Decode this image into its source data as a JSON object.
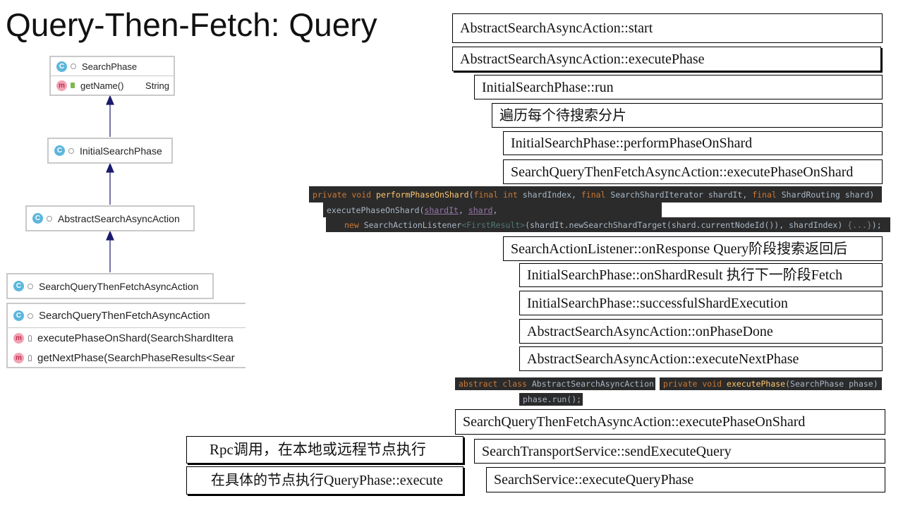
{
  "title": "Query-Then-Fetch: Query",
  "class_diagram": {
    "search_phase": {
      "icon": "C",
      "name": "SearchPhase",
      "method_icon": "m",
      "method": "getName()",
      "return_type": "String"
    },
    "initial_search_phase": {
      "icon": "C",
      "name": "InitialSearchPhase"
    },
    "abstract_search_async_action": {
      "icon": "C",
      "name": "AbstractSearchAsyncAction"
    },
    "search_query_then_fetch": {
      "icon": "C",
      "name": "SearchQueryThenFetchAsyncAction"
    },
    "detail": {
      "icon": "C",
      "name": "SearchQueryThenFetchAsyncAction",
      "methods": [
        {
          "icon": "m",
          "label": "executePhaseOnShard(SearchShardItera"
        },
        {
          "icon": "m",
          "label": "getNextPhase(SearchPhaseResults<Sear"
        }
      ]
    }
  },
  "call_stack": [
    "AbstractSearchAsyncAction::start",
    "AbstractSearchAsyncAction::executePhase",
    "InitialSearchPhase::run",
    "遍历每个待搜索分片",
    "InitialSearchPhase::performPhaseOnShard",
    "SearchQueryThenFetchAsyncAction::executePhaseOnShard",
    "SearchActionListener::onResponse Query阶段搜索返回后",
    "InitialSearchPhase::onShardResult  执行下一阶段Fetch",
    "InitialSearchPhase::successfulShardExecution",
    "AbstractSearchAsyncAction::onPhaseDone",
    "AbstractSearchAsyncAction::executeNextPhase",
    "SearchQueryThenFetchAsyncAction::executePhaseOnShard",
    "SearchTransportService::sendExecuteQuery",
    "SearchService::executeQueryPhase"
  ],
  "notes": {
    "rpc": "Rpc调用，在本地或远程节点执行",
    "query_phase": "在具体的节点执行QueryPhase::execute"
  },
  "code": {
    "perform_phase": {
      "line1": {
        "kw1": "private void ",
        "fn": "performPhaseOnShard",
        "p1": "(",
        "kw2": "final int ",
        "a1": "shardIndex, ",
        "kw3": "final ",
        "a2": "SearchShardIterator shardIt, ",
        "kw4": "final ",
        "a3": "ShardRouting shard)"
      },
      "line2": {
        "a1": "executePhaseOnShard(",
        "v1": "shardIt",
        "a2": ", ",
        "v2": "shard",
        "a3": ","
      },
      "line3": {
        "kw": "new ",
        "a1": "SearchActionListener",
        "g": "<FirstResult>",
        "a2": "(shardIt.newSearchShardTarget(shard.currentNodeId()), shardIndex) ",
        "f": "{...}",
        "a3": ");"
      }
    },
    "abstract_class": {
      "kw": "abstract class ",
      "name": "AbstractSearchAsyncAction"
    },
    "execute_phase": {
      "kw": "private void ",
      "fn": "executePhase",
      "args": "(SearchPhase phase)"
    },
    "phase_run": "phase.run();"
  }
}
